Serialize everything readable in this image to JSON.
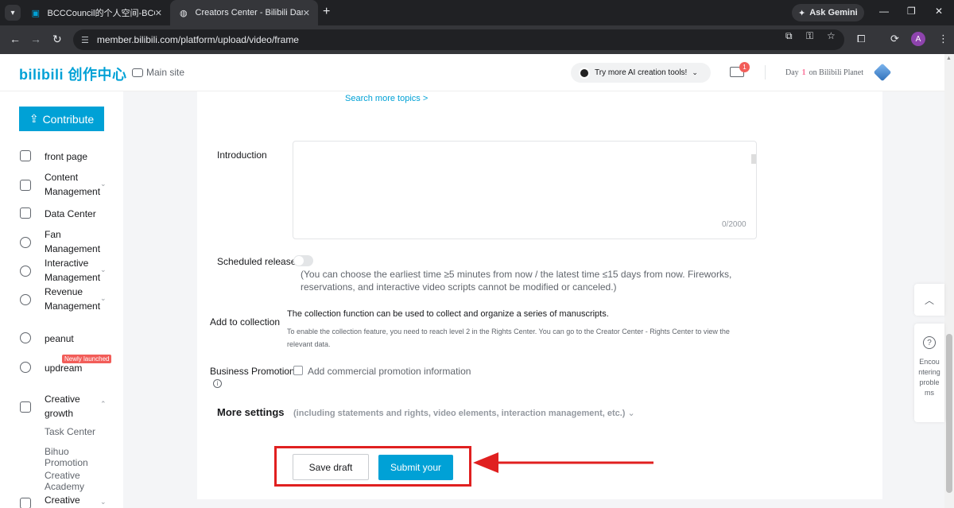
{
  "browser": {
    "tabs": [
      {
        "title": "BCCCouncil的个人空间-BCCCou",
        "favicon": "bilibili-tv-icon",
        "active": false
      },
      {
        "title": "Creators Center - Bilibili Danma",
        "favicon": "globe-icon",
        "active": true
      }
    ],
    "ask_gemini": "Ask Gemini",
    "url": "member.bilibili.com/platform/upload/video/frame",
    "profile_initial": "A"
  },
  "header": {
    "logo": "bilibili 创作中心",
    "main_site": "Main site",
    "ai_tools": "Try more AI creation tools!",
    "mail_badge": "1",
    "planet_prefix": "Day",
    "planet_day": "1",
    "planet_suffix": "on Bilibili Planet"
  },
  "sidebar": {
    "contribute": "Contribute",
    "items": [
      {
        "label": "front page"
      },
      {
        "label": "Content Management"
      },
      {
        "label": "Data Center"
      },
      {
        "label": "Fan Management"
      },
      {
        "label": "Interactive Management"
      },
      {
        "label": "Revenue Management"
      },
      {
        "label": "peanut"
      },
      {
        "label": "updream"
      },
      {
        "label": "Creative growth"
      }
    ],
    "new_badge": "Newly launched",
    "sub_items": [
      "Task Center",
      "Bihuo Promotion",
      "Creative Academy",
      "Creative"
    ]
  },
  "form": {
    "search_topics": "Search more topics >",
    "intro_label": "Introduction",
    "intro_count": "0/2000",
    "scheduled_label": "Scheduled release",
    "scheduled_desc": "(You can choose the earliest time ≥5 minutes from now / the latest time ≤15 days from now. Fireworks, reservations, and interactive video scripts cannot be modified or canceled.)",
    "collection_label": "Add to collection",
    "collection_title": "The collection function can be used to collect and organize a series of manuscripts.",
    "collection_desc": "To enable the collection feature, you need to reach level 2 in the Rights Center. You can go to the Creator Center - Rights Center to view the relevant data.",
    "business_label": "Business Promotion",
    "business_desc": "Add commercial promotion information",
    "more_settings": "More settings",
    "more_settings_desc": "(including statements and rights, video elements, interaction management, etc.)",
    "save_draft": "Save draft",
    "submit": "Submit your"
  },
  "help": {
    "text": "Encountering problems"
  },
  "colors": {
    "accent": "#00a1d6",
    "annotation_red": "#e02020"
  }
}
